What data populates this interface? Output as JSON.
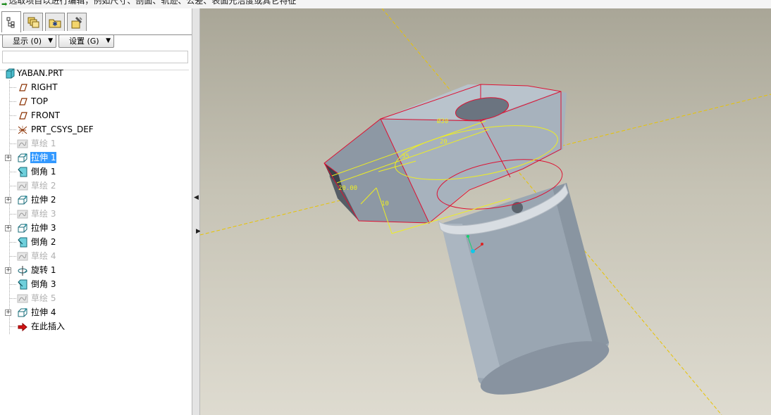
{
  "message": {
    "text": "选取项目以进行编辑，例如尺寸、剖面、轨迹、公差、表面光洁度或其它特征"
  },
  "panel": {
    "tabs": [
      {
        "name": "model-tree",
        "icon": "model-tree-icon"
      },
      {
        "name": "folder-browser",
        "icon": "layers-icon"
      },
      {
        "name": "favorites",
        "icon": "favorites-icon"
      },
      {
        "name": "connections",
        "icon": "tools-icon"
      }
    ],
    "show_label": "显示 (0)",
    "settings_label": "设置 (G)"
  },
  "tree": {
    "root": "YABAN.PRT",
    "items": [
      {
        "label": "RIGHT",
        "icon": "datum-plane-icon",
        "expandable": false,
        "state": "normal"
      },
      {
        "label": "TOP",
        "icon": "datum-plane-icon",
        "expandable": false,
        "state": "normal"
      },
      {
        "label": "FRONT",
        "icon": "datum-plane-icon",
        "expandable": false,
        "state": "normal"
      },
      {
        "label": "PRT_CSYS_DEF",
        "icon": "csys-icon",
        "expandable": false,
        "state": "normal"
      },
      {
        "label": "草绘 1",
        "icon": "sketch-icon",
        "expandable": false,
        "state": "dim"
      },
      {
        "label": "拉伸 1",
        "icon": "extrude-icon",
        "expandable": true,
        "state": "selected"
      },
      {
        "label": "倒角 1",
        "icon": "chamfer-icon",
        "expandable": false,
        "state": "normal"
      },
      {
        "label": "草绘 2",
        "icon": "sketch-icon",
        "expandable": false,
        "state": "dim"
      },
      {
        "label": "拉伸 2",
        "icon": "extrude-icon",
        "expandable": true,
        "state": "normal"
      },
      {
        "label": "草绘 3",
        "icon": "sketch-icon",
        "expandable": false,
        "state": "dim"
      },
      {
        "label": "拉伸 3",
        "icon": "extrude-icon",
        "expandable": true,
        "state": "normal"
      },
      {
        "label": "倒角 2",
        "icon": "chamfer-icon",
        "expandable": false,
        "state": "normal"
      },
      {
        "label": "草绘 4",
        "icon": "sketch-icon",
        "expandable": false,
        "state": "dim"
      },
      {
        "label": "旋转 1",
        "icon": "revolve-icon",
        "expandable": true,
        "state": "normal"
      },
      {
        "label": "倒角 3",
        "icon": "chamfer-icon",
        "expandable": false,
        "state": "normal"
      },
      {
        "label": "草绘 5",
        "icon": "sketch-icon",
        "expandable": false,
        "state": "dim"
      },
      {
        "label": "拉伸 4",
        "icon": "extrude-icon",
        "expandable": true,
        "state": "normal"
      },
      {
        "label": "在此插入",
        "icon": "insert-here-icon",
        "expandable": false,
        "state": "normal"
      }
    ]
  },
  "viewport": {
    "dims": [
      "Ø30",
      "20",
      "35",
      "10",
      "20.00"
    ],
    "colors": {
      "edge_highlight": "#dd1133",
      "dimension": "#eeee22",
      "datum_axis": "#e8c400",
      "part": "#a7b2bd"
    }
  }
}
